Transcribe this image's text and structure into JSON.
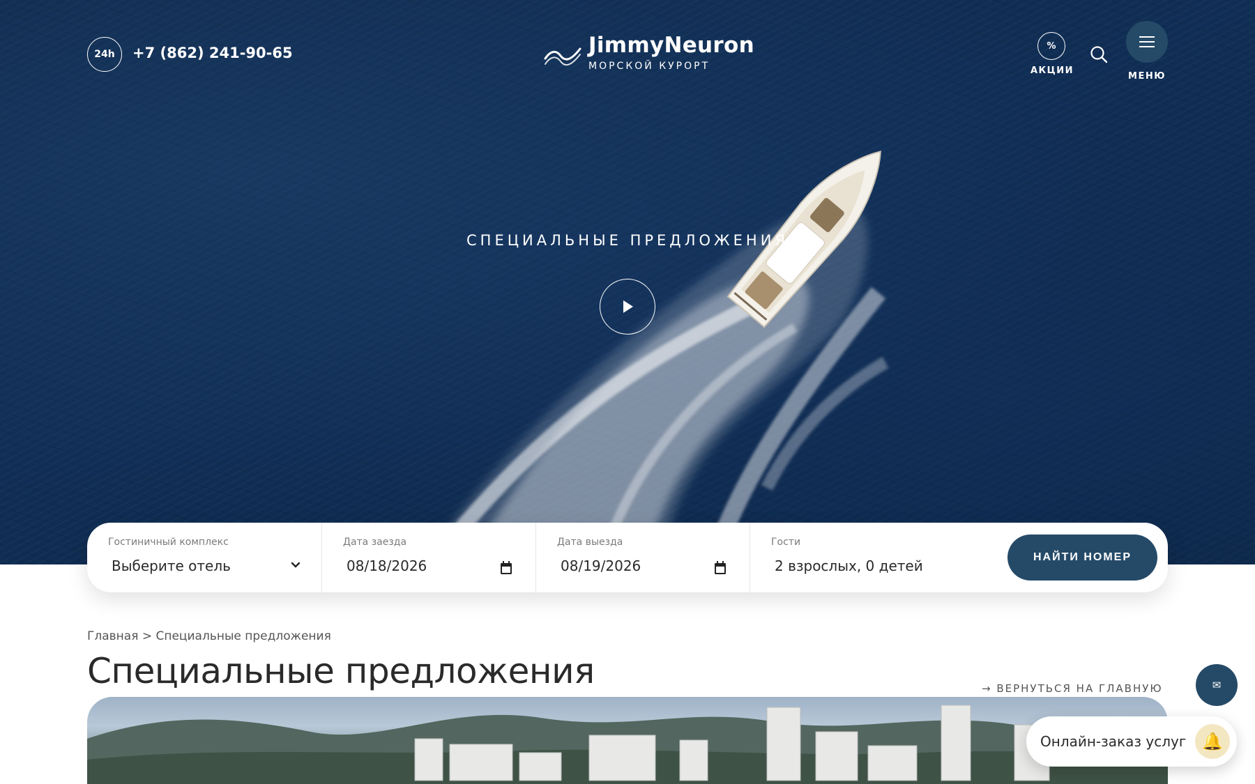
{
  "header": {
    "badge_24h": "24h",
    "phone": "+7 (862) 241-90-65",
    "logo_name": "JimmyNeuron",
    "logo_sub": "МОРСКОЙ КУРОРТ",
    "promo_symbol": "%",
    "promo_label": "АКЦИИ",
    "menu_label": "МЕНЮ"
  },
  "hero": {
    "title": "СПЕЦИАЛЬНЫЕ ПРЕДЛОЖЕНИЯ"
  },
  "booking": {
    "hotel_label": "Гостиничный комплекс",
    "hotel_value": "Выберите отель",
    "checkin_label": "Дата заезда",
    "checkin_value": "08/18/2026",
    "checkout_label": "Дата выезда",
    "checkout_value": "08/19/2026",
    "guests_label": "Гости",
    "guests_value": "2 взрослых, 0 детей",
    "find_button": "НАЙТИ НОМЕР"
  },
  "content": {
    "breadcrumb": "Главная > Специальные предложения",
    "page_title": "Специальные предложения",
    "back_link": "→ ВЕРНУТЬСЯ НА ГЛАВНУЮ"
  },
  "widgets": {
    "online_order": "Онлайн-заказ услуг"
  },
  "colors": {
    "accent": "#254a68",
    "sea": "#0f2a4c"
  }
}
